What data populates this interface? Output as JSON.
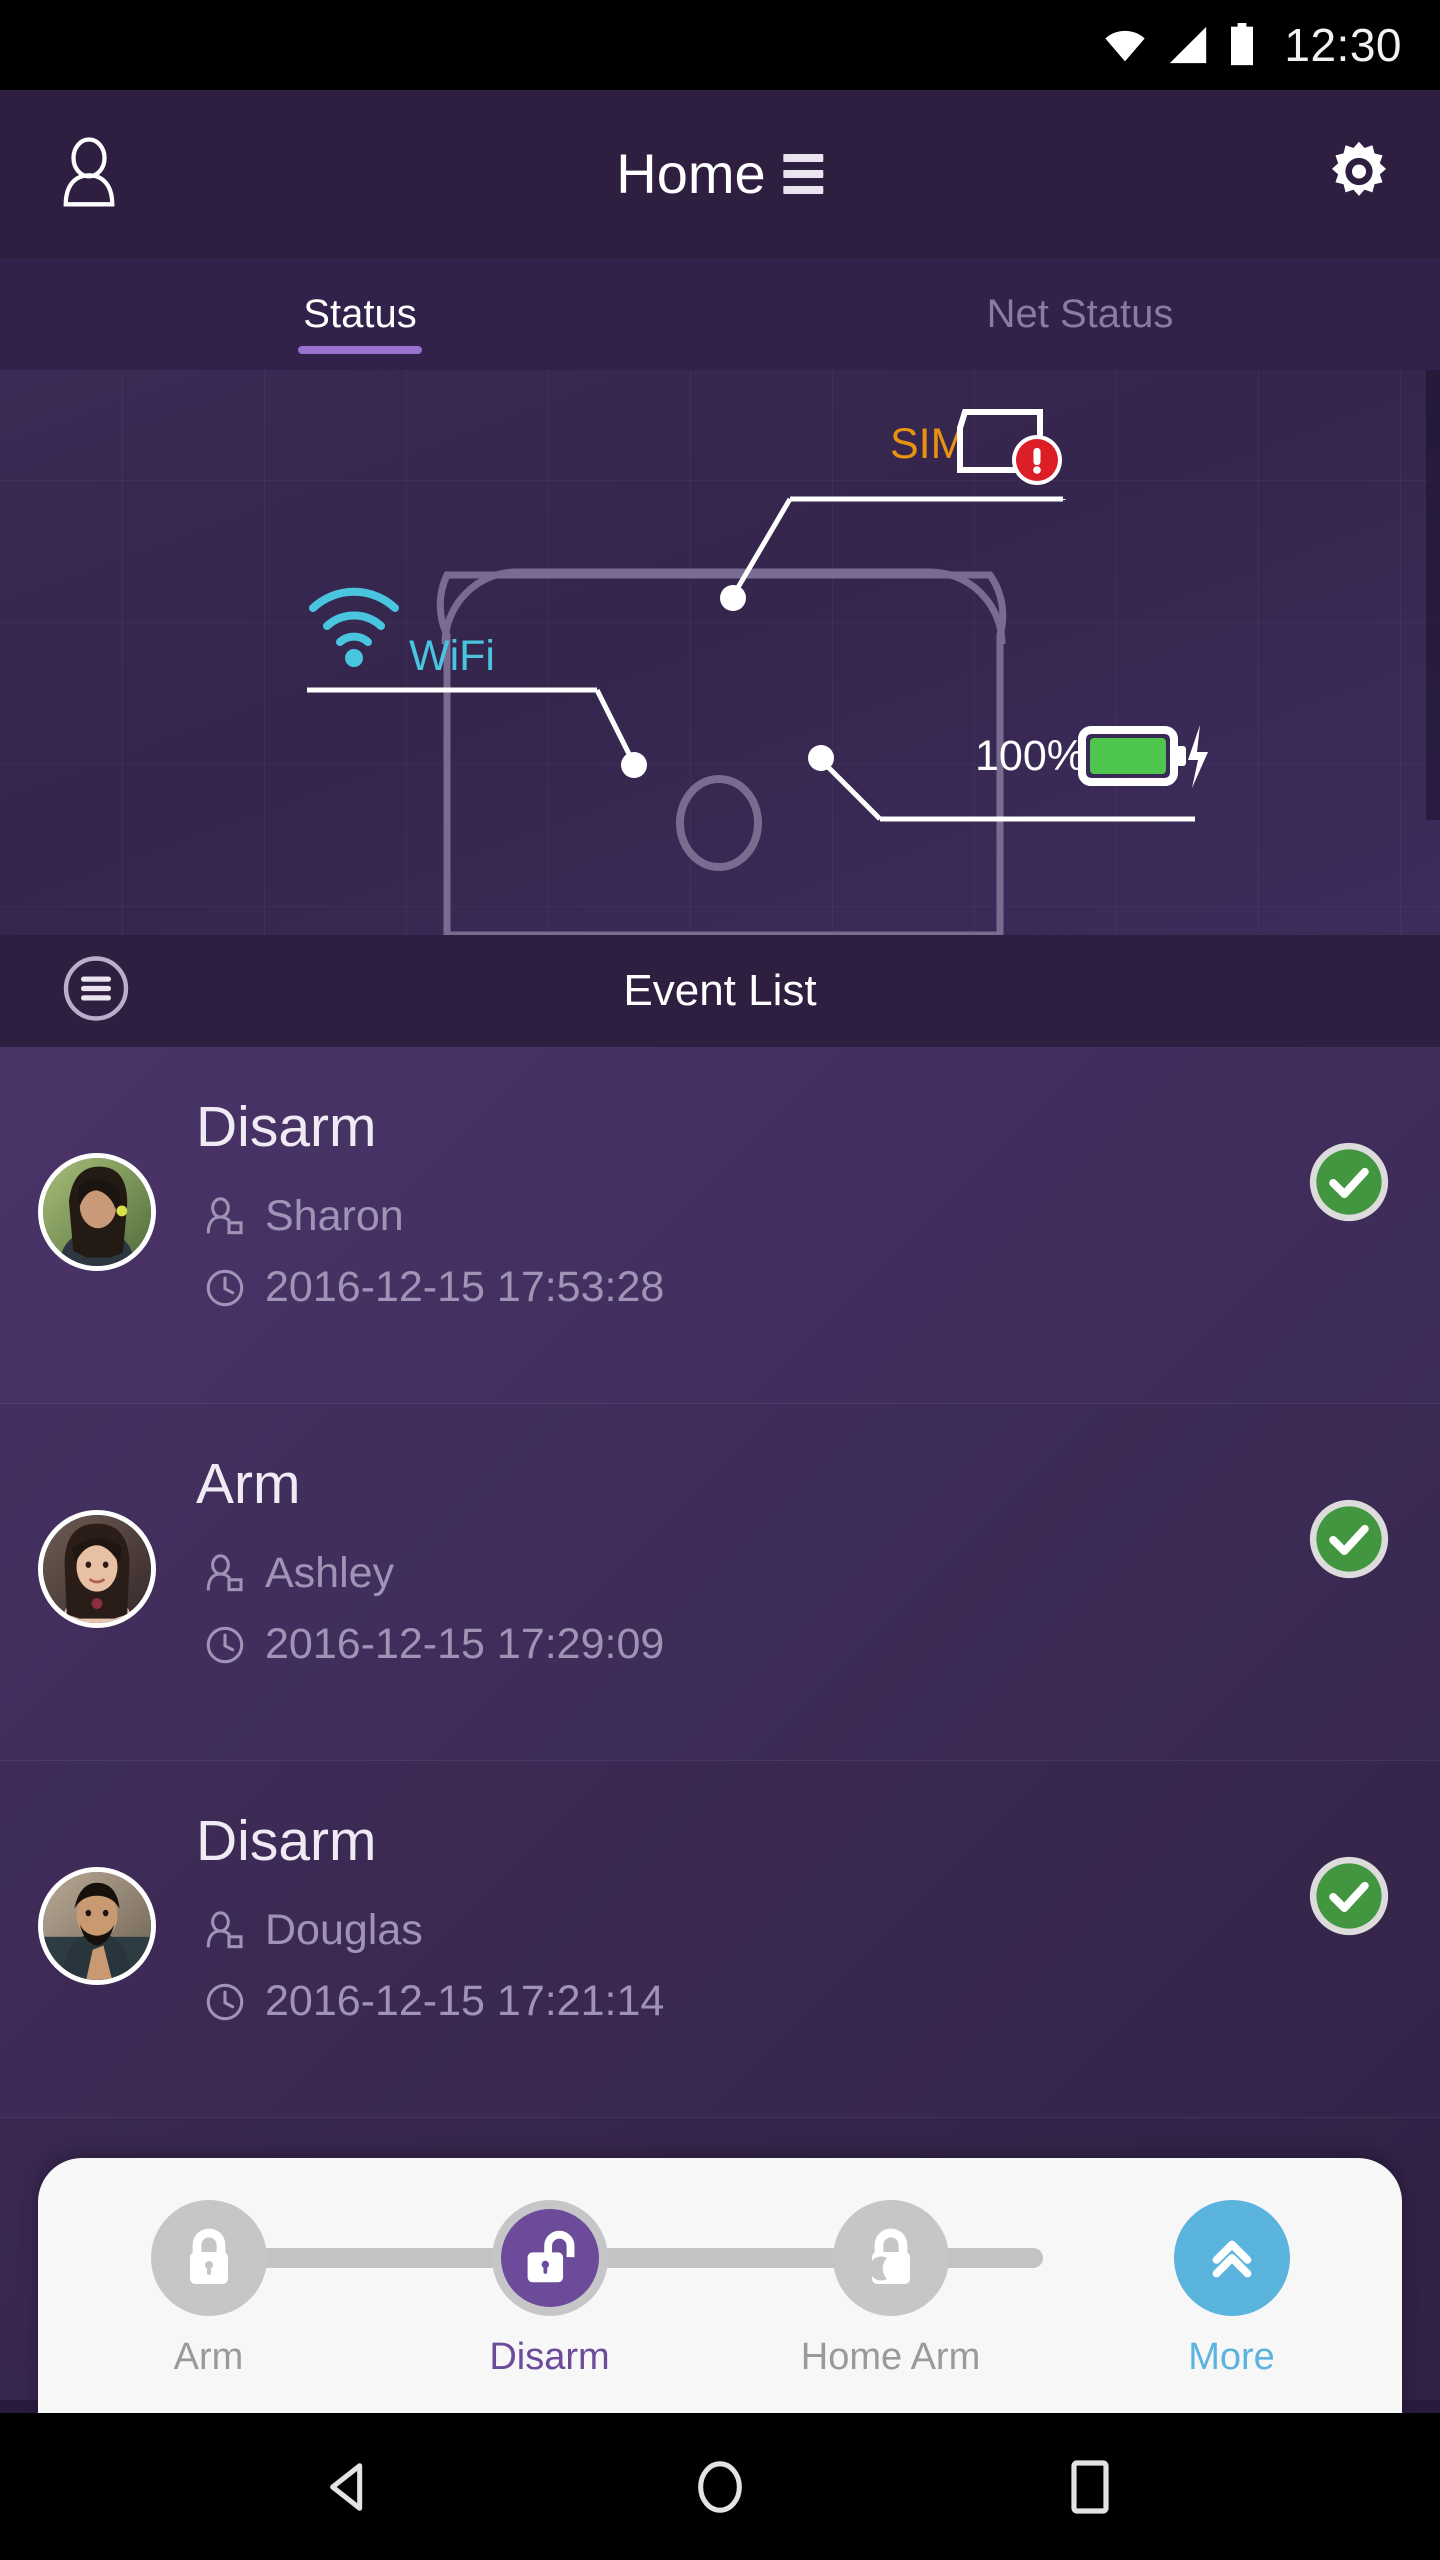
{
  "system_bar": {
    "time": "12:30",
    "icons": [
      "wifi-icon",
      "cellular-signal-icon",
      "battery-icon"
    ]
  },
  "app_bar": {
    "title": "Home",
    "profile_icon": "person-icon",
    "menu_icon": "list-menu-icon",
    "settings_icon": "gear-icon"
  },
  "tabs": [
    {
      "label": "Status",
      "active": true
    },
    {
      "label": "Net Status",
      "active": false
    }
  ],
  "status_panel": {
    "callouts": [
      {
        "key": "sim",
        "label": "SIM",
        "color": "#e8920f",
        "state": "error",
        "icon": "sim-card-icon"
      },
      {
        "key": "wifi",
        "label": "WiFi",
        "color": "#49c5e0",
        "state": "ok",
        "icon": "wifi-signal-icon"
      },
      {
        "key": "battery",
        "label": "100%",
        "color": "#ffffff",
        "state": "charging",
        "icon": "battery-charging-icon"
      }
    ],
    "battery_percent": "100%",
    "battery_fill_color": "#4ec64e",
    "device_outline_color": "#7a6b91"
  },
  "event_list": {
    "header": "Event List",
    "menu_icon": "list-menu-circle-icon",
    "events": [
      {
        "action": "Disarm",
        "user": "Sharon",
        "timestamp": "2016-12-15 17:53:28",
        "status": "success"
      },
      {
        "action": "Arm",
        "user": "Ashley",
        "timestamp": "2016-12-15 17:29:09",
        "status": "success"
      },
      {
        "action": "Disarm",
        "user": "Douglas",
        "timestamp": "2016-12-15 17:21:14",
        "status": "success"
      }
    ],
    "user_icon": "person-small-icon",
    "time_icon": "clock-icon",
    "status_icon": "check-circle-icon",
    "status_color": "#41963f"
  },
  "action_bar": {
    "items": [
      {
        "label": "Arm",
        "icon": "lock-closed-icon",
        "active": false
      },
      {
        "label": "Disarm",
        "icon": "lock-open-icon",
        "active": true
      },
      {
        "label": "Home Arm",
        "icon": "lock-moon-icon",
        "active": false
      },
      {
        "label": "More",
        "icon": "chevron-double-up-icon",
        "active": false,
        "accent": "#5ab4dd"
      }
    ]
  },
  "nav_bar": {
    "back": "back-triangle-icon",
    "home": "home-circle-icon",
    "recents": "recents-square-icon"
  }
}
